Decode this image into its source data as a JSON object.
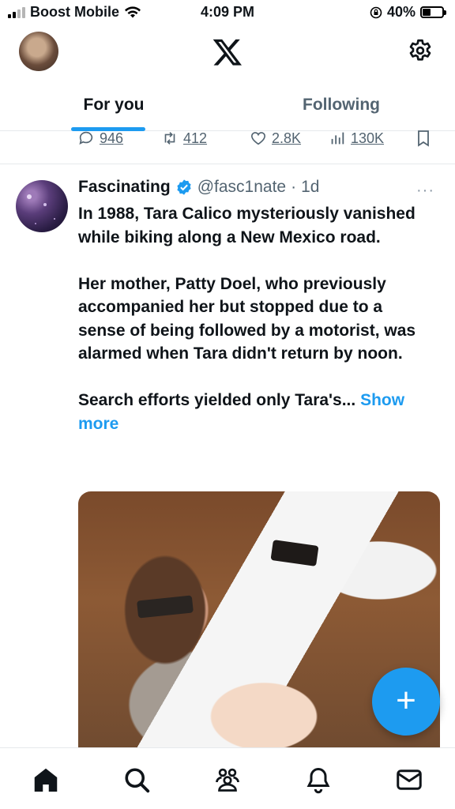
{
  "status_bar": {
    "carrier": "Boost Mobile",
    "time": "4:09 PM",
    "battery": "40%",
    "battery_level": 0.4
  },
  "header": {
    "logo_icon": "x-logo-icon",
    "settings_icon": "gear-icon"
  },
  "tabs": [
    {
      "label": "For you",
      "active": true
    },
    {
      "label": "Following",
      "active": false
    }
  ],
  "previous_tweet_actions": {
    "replies": "946",
    "reposts": "412",
    "likes": "2.8K",
    "views": "130K"
  },
  "tweet": {
    "name": "Fascinating",
    "handle": "@fasc1nate",
    "dot": "·",
    "time": "1d",
    "more": "···",
    "paragraphs": [
      "In 1988, Tara Calico mysteriously vanished while biking along a New Mexico road.",
      "Her mother, Patty Doel, who previously accompanied her but stopped due to a sense of being followed by a motorist, was alarmed when Tara didn't return by noon.",
      "Search efforts yielded only Tara's..."
    ],
    "show_more": "Show more"
  },
  "fab": {
    "label": "+"
  },
  "bottom_nav": [
    "home-icon",
    "search-icon",
    "communities-icon",
    "notifications-icon",
    "messages-icon"
  ],
  "colors": {
    "accent": "#1d9bf0",
    "text": "#0f1419",
    "secondary": "#536471"
  }
}
